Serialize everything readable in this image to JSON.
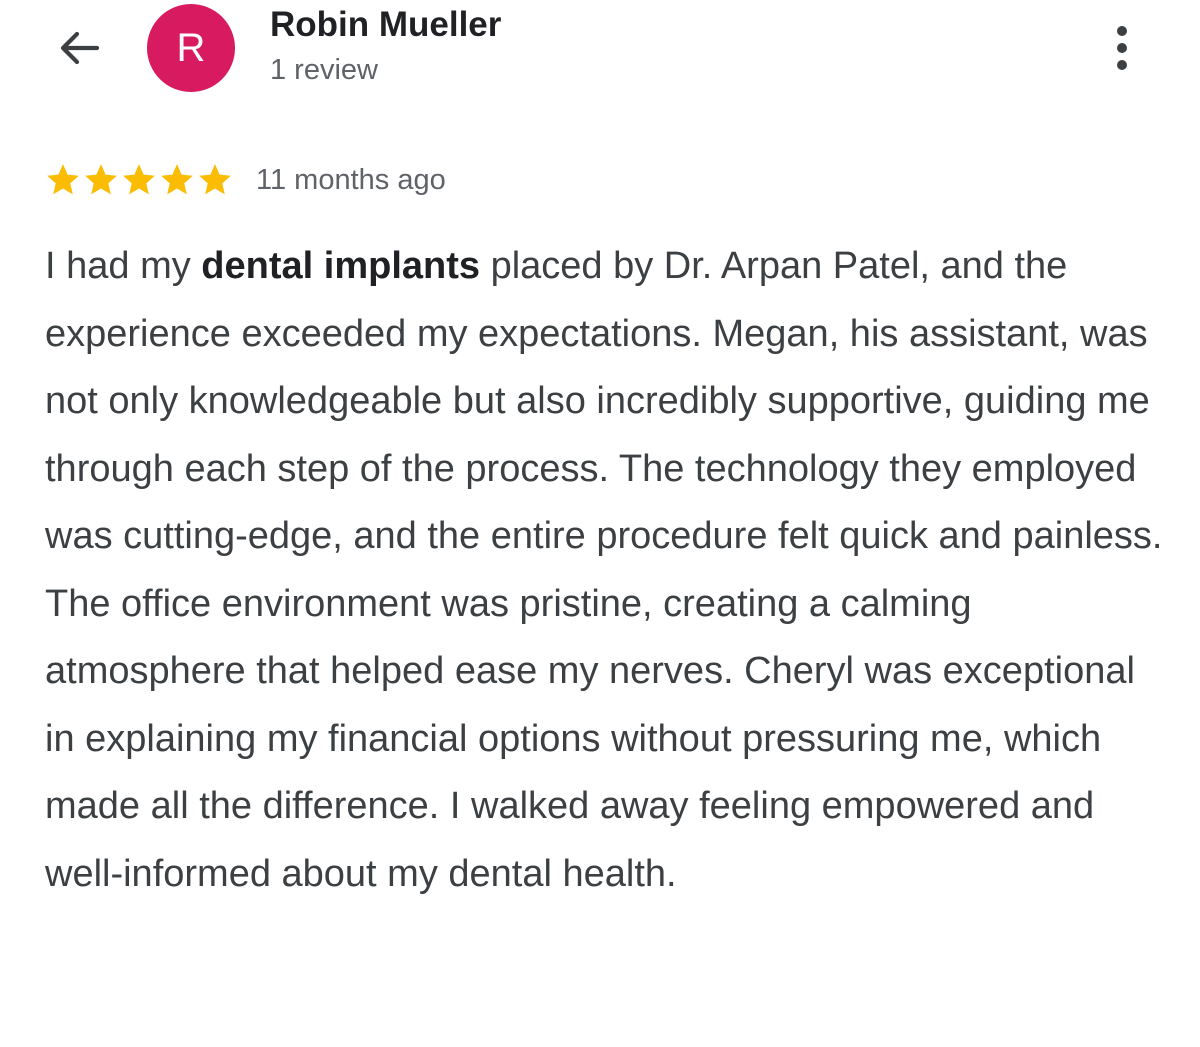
{
  "header": {
    "back_icon": "arrow-left-icon",
    "avatar": {
      "letter": "R",
      "color": "#d81b60"
    },
    "user_name": "Robin Mueller",
    "review_count": "1 review",
    "more_icon": "more-vertical-icon"
  },
  "review": {
    "rating": 5,
    "rating_max": 5,
    "star_color": "#fbbc04",
    "time_ago": "11 months ago",
    "text": {
      "intro": "I had my ",
      "highlight": "dental implants",
      "rest": " placed by Dr. Arpan Patel, and the experience exceeded my expectations. Megan, his assistant, was not only knowledgeable but also incredibly supportive, guiding me through each step of the process. The technology they employed was cutting-edge, and the entire procedure felt quick and painless. The office environment was pristine, creating a calming atmosphere that helped ease my nerves. Cheryl was exceptional in explaining my financial options without pressuring me, which made all the difference. I walked away feeling empowered and well-informed about my dental health."
    }
  }
}
